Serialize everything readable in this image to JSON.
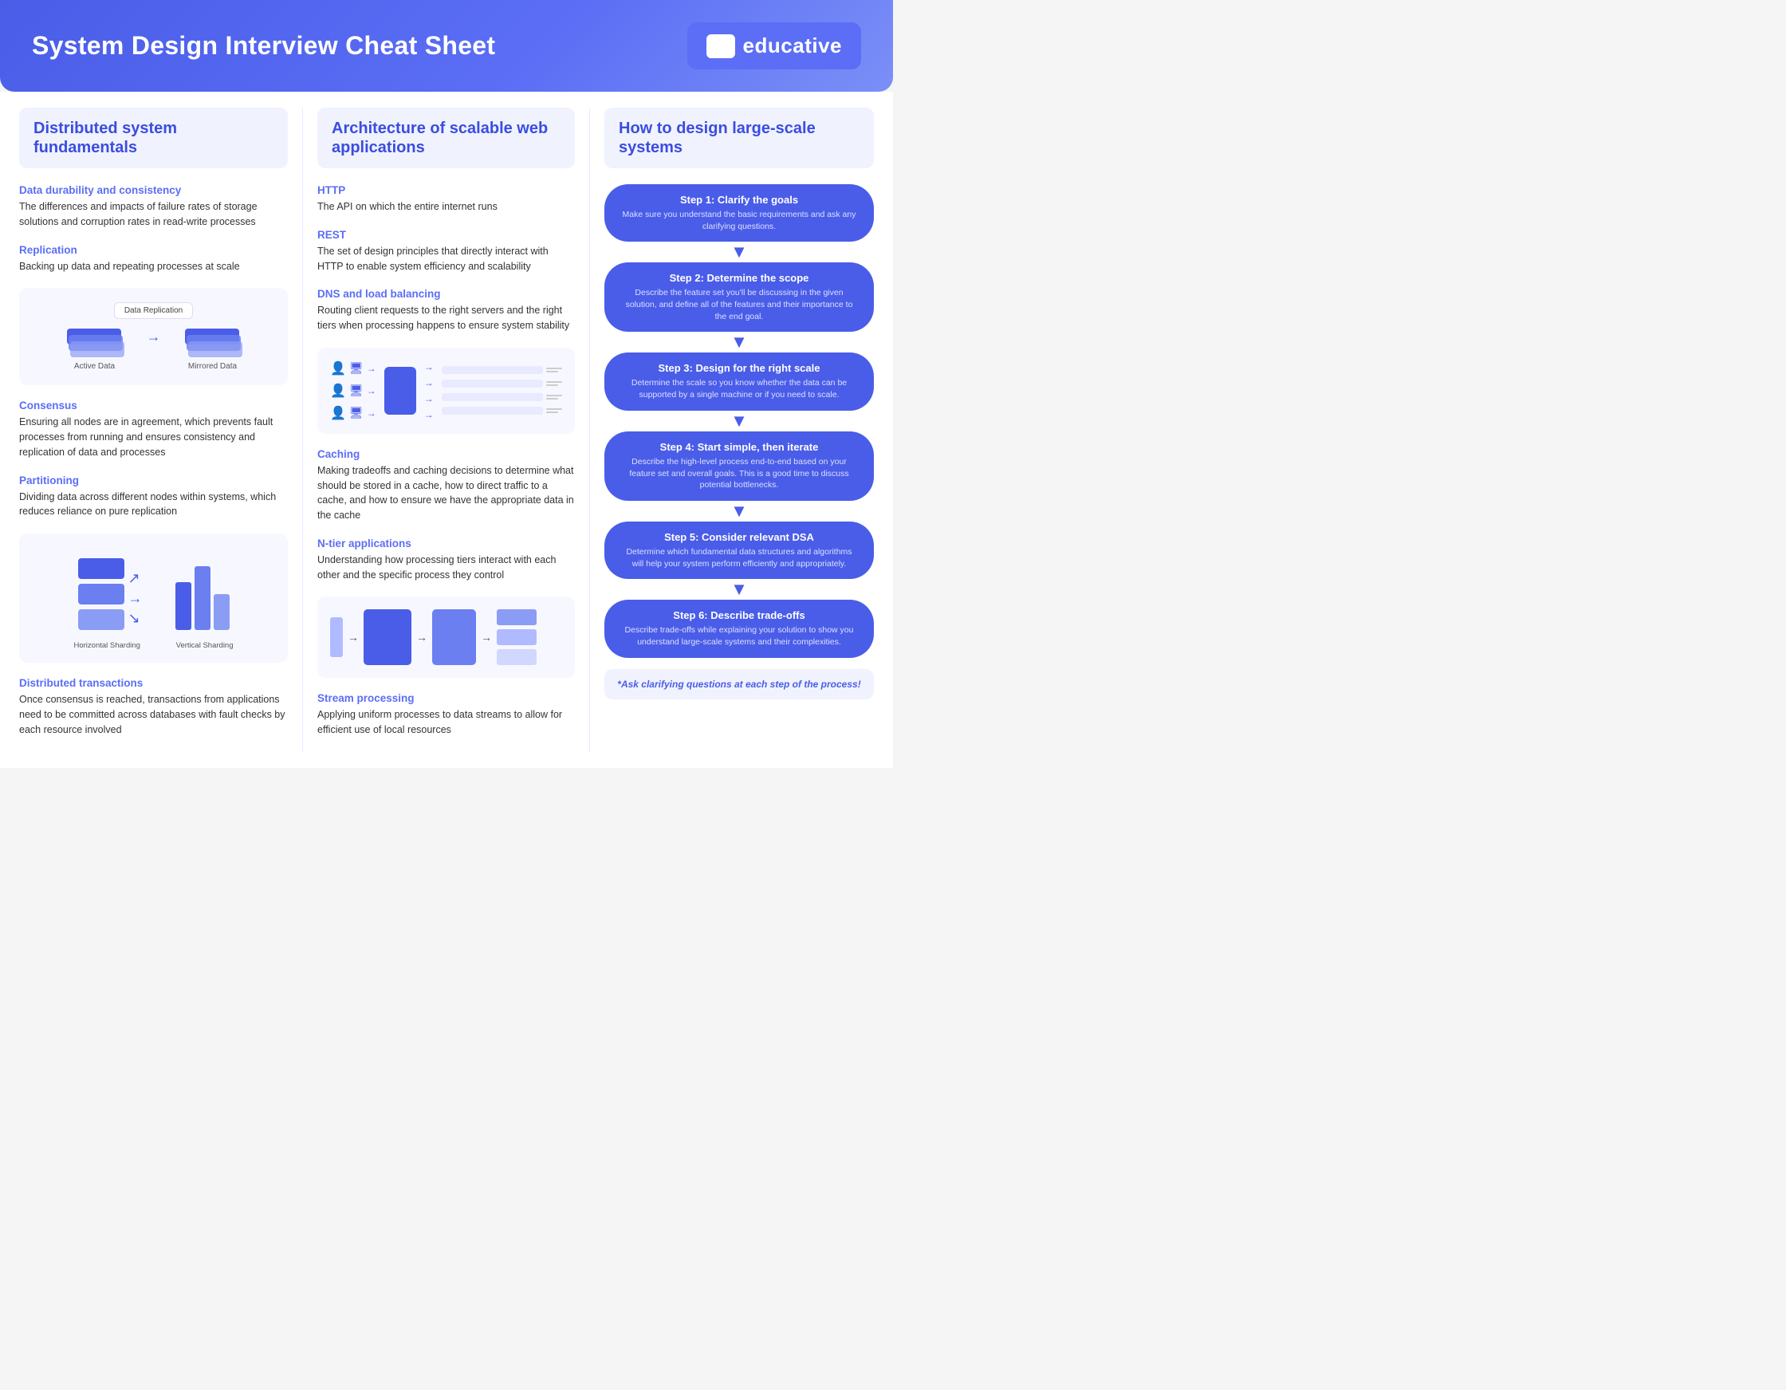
{
  "header": {
    "title": "System Design Interview Cheat Sheet",
    "logo_text": "educative",
    "logo_icon": "⊞"
  },
  "col1": {
    "section_title": "Distributed system fundamentals",
    "topics": [
      {
        "title": "Data durability and consistency",
        "desc": "The differences and impacts of failure rates of storage solutions and corruption rates in read-write processes"
      },
      {
        "title": "Replication",
        "desc": "Backing up data and repeating processes at scale"
      },
      {
        "title": "Consensus",
        "desc": "Ensuring all nodes are in agreement, which prevents fault processes from running and ensures consistency and replication of data and processes"
      },
      {
        "title": "Partitioning",
        "desc": "Dividing data across different nodes within systems, which reduces reliance on pure replication"
      },
      {
        "title": "Distributed transactions",
        "desc": "Once consensus is reached, transactions from applications need to be committed across databases with fault checks by each resource involved"
      }
    ],
    "replication_diagram": {
      "label": "Data Replication",
      "active_data": "Active Data",
      "mirrored_data": "Mirrored Data"
    },
    "sharding_diagram": {
      "horizontal_label": "Horizontal Sharding",
      "vertical_label": "Vertical Sharding"
    }
  },
  "col2": {
    "section_title": "Architecture of scalable web applications",
    "topics": [
      {
        "title": "HTTP",
        "desc": "The API on which the entire internet runs"
      },
      {
        "title": "REST",
        "desc": "The set of design principles that directly interact with HTTP to enable system efficiency and scalability"
      },
      {
        "title": "DNS and load balancing",
        "desc": "Routing client requests to the right servers and the right tiers when processing happens to ensure system stability"
      },
      {
        "title": "Caching",
        "desc": "Making tradeoffs and caching decisions to determine what should be stored in a cache, how to direct traffic to a cache, and how to ensure we have the appropriate data in the cache"
      },
      {
        "title": "N-tier applications",
        "desc": "Understanding how processing tiers interact with each other and the specific process they control"
      },
      {
        "title": "Stream processing",
        "desc": "Applying uniform processes to data streams to allow for efficient use of local resources"
      }
    ]
  },
  "col3": {
    "section_title": "How to design large-scale systems",
    "steps": [
      {
        "number": 1,
        "title": "Step 1: Clarify the goals",
        "desc": "Make sure you understand the basic requirements and ask any clarifying questions."
      },
      {
        "number": 2,
        "title": "Step 2: Determine the scope",
        "desc": "Describe the feature set you'll be discussing in the given solution, and define all of the features and their importance to the end goal."
      },
      {
        "number": 3,
        "title": "Step 3: Design for the right scale",
        "desc": "Determine the scale so you know whether the data can be supported by a single machine or if you need to scale."
      },
      {
        "number": 4,
        "title": "Step 4: Start simple, then iterate",
        "desc": "Describe the high-level process end-to-end based on your feature set and overall goals. This is a good time to discuss potential bottlenecks."
      },
      {
        "number": 5,
        "title": "Step 5: Consider relevant DSA",
        "desc": "Determine which fundamental data structures and algorithms will help your system perform efficiently and appropriately."
      },
      {
        "number": 6,
        "title": "Step 6: Describe trade-offs",
        "desc": "Describe trade-offs while explaining your solution to show you understand large-scale systems and their complexities."
      }
    ],
    "clarify_note": "*Ask clarifying questions at each step of the process!"
  }
}
